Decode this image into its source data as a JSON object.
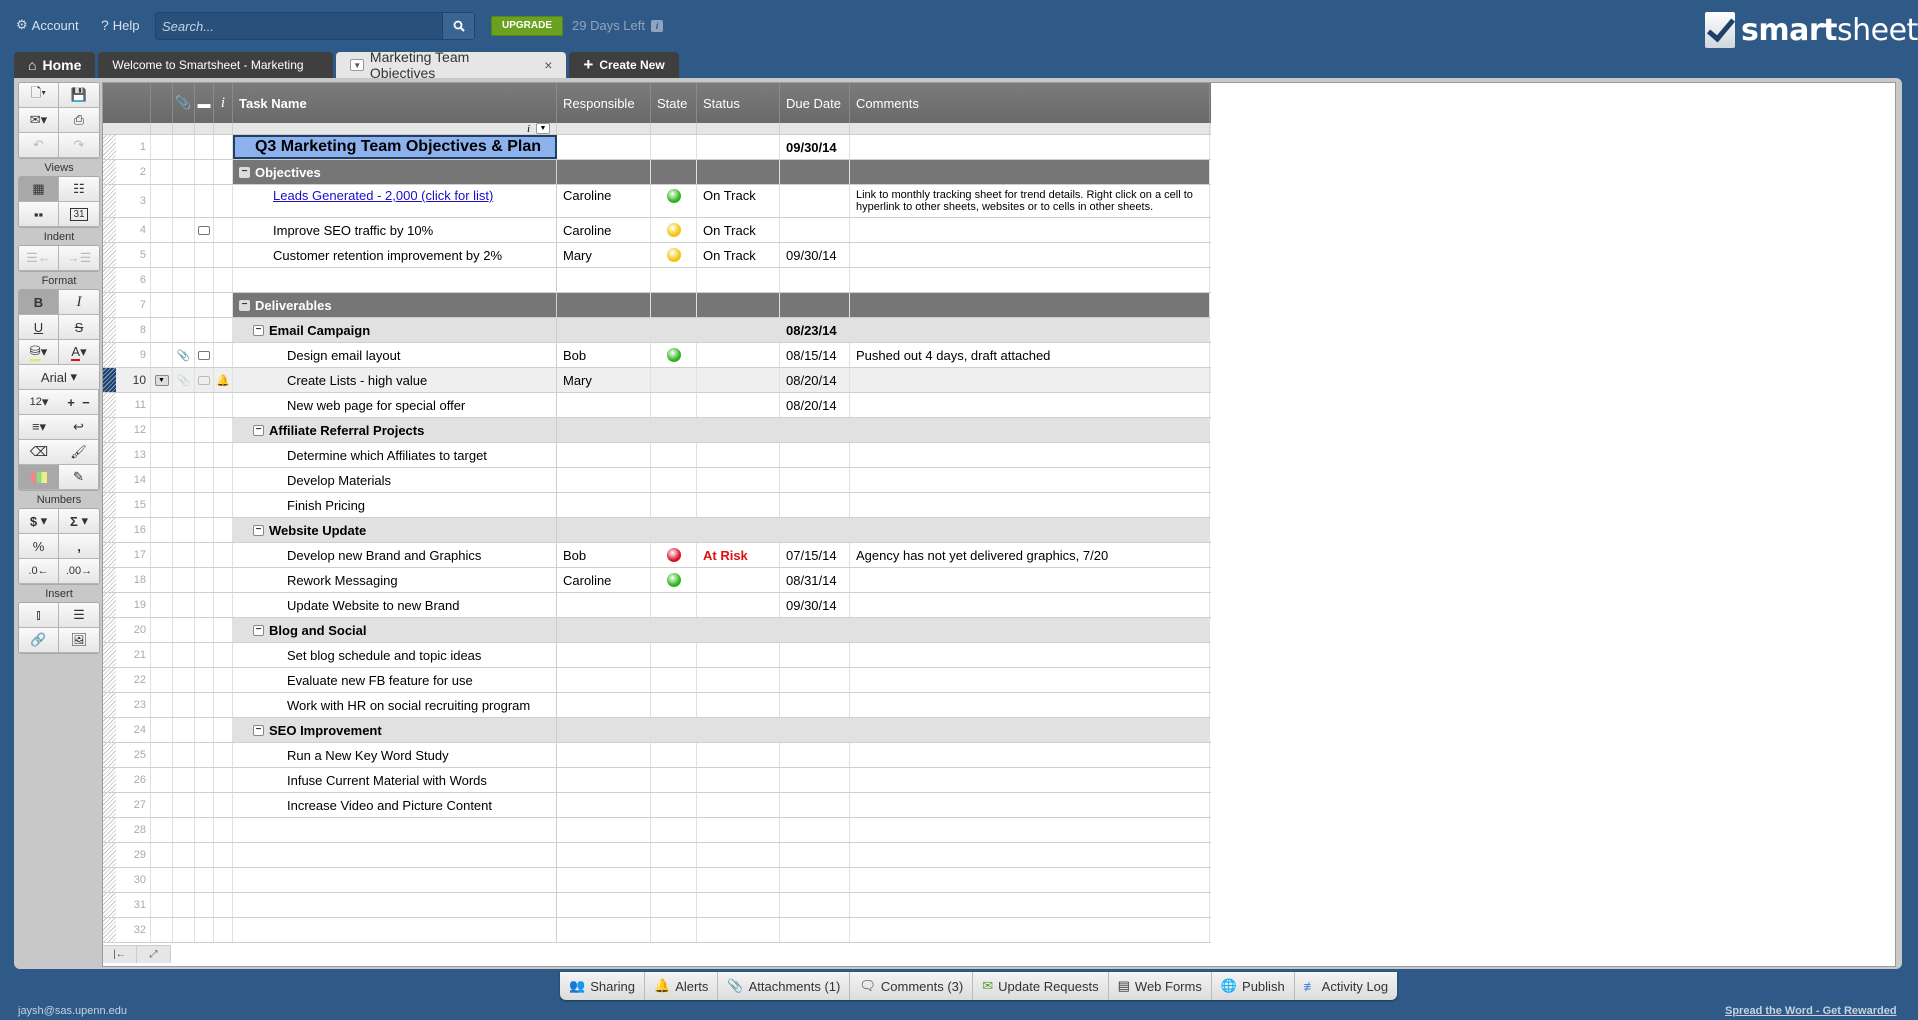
{
  "topbar": {
    "account_label": "Account",
    "help_label": "Help",
    "search_placeholder": "Search...",
    "upgrade_label": "UPGRADE",
    "trial_text": "29 Days Left",
    "logo_bold": "smart",
    "logo_rest": "sheet"
  },
  "tabs": {
    "home": "Home",
    "welcome": "Welcome to Smartsheet - Marketing",
    "active": "Marketing Team Objectives",
    "create": "Create New"
  },
  "toolbar": {
    "views_label": "Views",
    "indent_label": "Indent",
    "format_label": "Format",
    "font_name": "Arial",
    "font_size": "12",
    "numbers_label": "Numbers",
    "insert_label": "Insert"
  },
  "columns": {
    "task": "Task Name",
    "responsible": "Responsible",
    "state": "State",
    "status": "Status",
    "due": "Due Date",
    "comments": "Comments"
  },
  "colors": {
    "green": "#2db31a",
    "yellow": "#f2c40c",
    "red": "#d9102b"
  },
  "rows": [
    {
      "n": "1",
      "type": "title",
      "task": "Q3 Marketing Team Objectives & Plan",
      "resp": "",
      "state": "",
      "status": "",
      "due": "09/30/14",
      "comments": ""
    },
    {
      "n": "2",
      "type": "parent1",
      "level": 0,
      "task": "Objectives",
      "resp": "",
      "state": "",
      "status": "",
      "due": "",
      "comments": ""
    },
    {
      "n": "3",
      "type": "child",
      "level": 1,
      "link": true,
      "tall": true,
      "task": "Leads Generated - 2,000 (click for list)",
      "resp": "Caroline",
      "state": "green",
      "status": "On Track",
      "due": "",
      "comments": "Link to monthly tracking sheet for trend details. Right click on a cell to hyperlink to other sheets, websites or to cells in other sheets."
    },
    {
      "n": "4",
      "type": "child",
      "level": 1,
      "comment_icon": true,
      "task": "Improve SEO traffic by 10%",
      "resp": "Caroline",
      "state": "yellow",
      "status": "On Track",
      "due": "",
      "comments": ""
    },
    {
      "n": "5",
      "type": "child",
      "level": 1,
      "task": "Customer retention improvement by 2%",
      "resp": "Mary",
      "state": "yellow",
      "status": "On Track",
      "due": "09/30/14",
      "comments": ""
    },
    {
      "n": "6",
      "type": "empty",
      "task": "",
      "resp": "",
      "state": "",
      "status": "",
      "due": "",
      "comments": ""
    },
    {
      "n": "7",
      "type": "parent1",
      "level": 0,
      "task": "Deliverables",
      "resp": "",
      "state": "",
      "status": "",
      "due": "",
      "comments": ""
    },
    {
      "n": "8",
      "type": "parent2",
      "level": 1,
      "task": "Email Campaign",
      "resp": "",
      "state": "",
      "status": "",
      "due": "08/23/14",
      "comments": ""
    },
    {
      "n": "9",
      "type": "child",
      "level": 2,
      "attach_icon": true,
      "comment_icon": true,
      "task": "Design email layout",
      "resp": "Bob",
      "state": "green",
      "status": "",
      "due": "08/15/14",
      "comments": "Pushed out 4 days, draft attached"
    },
    {
      "n": "10",
      "type": "child",
      "level": 2,
      "selected": true,
      "task": "Create Lists - high value",
      "resp": "Mary",
      "state": "",
      "status": "",
      "due": "08/20/14",
      "comments": ""
    },
    {
      "n": "11",
      "type": "child",
      "level": 2,
      "task": "New web page for special offer",
      "resp": "",
      "state": "",
      "status": "",
      "due": "08/20/14",
      "comments": ""
    },
    {
      "n": "12",
      "type": "parent2",
      "level": 1,
      "task": "Affiliate Referral Projects",
      "resp": "",
      "state": "",
      "status": "",
      "due": "",
      "comments": ""
    },
    {
      "n": "13",
      "type": "child",
      "level": 2,
      "task": "Determine which Affiliates to target",
      "resp": "",
      "state": "",
      "status": "",
      "due": "",
      "comments": ""
    },
    {
      "n": "14",
      "type": "child",
      "level": 2,
      "task": "Develop Materials",
      "resp": "",
      "state": "",
      "status": "",
      "due": "",
      "comments": ""
    },
    {
      "n": "15",
      "type": "child",
      "level": 2,
      "task": "Finish Pricing",
      "resp": "",
      "state": "",
      "status": "",
      "due": "",
      "comments": ""
    },
    {
      "n": "16",
      "type": "parent2",
      "level": 1,
      "task": "Website Update",
      "resp": "",
      "state": "",
      "status": "",
      "due": "",
      "comments": ""
    },
    {
      "n": "17",
      "type": "child",
      "level": 2,
      "task": "Develop new Brand and Graphics",
      "resp": "Bob",
      "state": "red",
      "status": "At Risk",
      "due": "07/15/14",
      "comments": "Agency has not yet delivered graphics, 7/20"
    },
    {
      "n": "18",
      "type": "child",
      "level": 2,
      "task": "Rework Messaging",
      "resp": "Caroline",
      "state": "green",
      "status": "",
      "due": "08/31/14",
      "comments": ""
    },
    {
      "n": "19",
      "type": "child",
      "level": 2,
      "task": "Update Website to new Brand",
      "resp": "",
      "state": "",
      "status": "",
      "due": "09/30/14",
      "comments": ""
    },
    {
      "n": "20",
      "type": "parent2",
      "level": 1,
      "task": "Blog and Social",
      "resp": "",
      "state": "",
      "status": "",
      "due": "",
      "comments": ""
    },
    {
      "n": "21",
      "type": "child",
      "level": 2,
      "task": "Set blog schedule and topic ideas",
      "resp": "",
      "state": "",
      "status": "",
      "due": "",
      "comments": ""
    },
    {
      "n": "22",
      "type": "child",
      "level": 2,
      "task": "Evaluate new FB feature for use",
      "resp": "",
      "state": "",
      "status": "",
      "due": "",
      "comments": ""
    },
    {
      "n": "23",
      "type": "child",
      "level": 2,
      "task": "Work with HR on social recruiting program",
      "resp": "",
      "state": "",
      "status": "",
      "due": "",
      "comments": ""
    },
    {
      "n": "24",
      "type": "parent2",
      "level": 1,
      "task": "SEO Improvement",
      "resp": "",
      "state": "",
      "status": "",
      "due": "",
      "comments": ""
    },
    {
      "n": "25",
      "type": "child",
      "level": 2,
      "task": "Run a New Key Word Study",
      "resp": "",
      "state": "",
      "status": "",
      "due": "",
      "comments": ""
    },
    {
      "n": "26",
      "type": "child",
      "level": 2,
      "task": "Infuse Current Material with Words",
      "resp": "",
      "state": "",
      "status": "",
      "due": "",
      "comments": ""
    },
    {
      "n": "27",
      "type": "child",
      "level": 2,
      "task": "Increase Video and Picture Content",
      "resp": "",
      "state": "",
      "status": "",
      "due": "",
      "comments": ""
    },
    {
      "n": "28",
      "type": "empty",
      "task": "",
      "resp": "",
      "state": "",
      "status": "",
      "due": "",
      "comments": ""
    },
    {
      "n": "29",
      "type": "empty",
      "task": "",
      "resp": "",
      "state": "",
      "status": "",
      "due": "",
      "comments": ""
    },
    {
      "n": "30",
      "type": "empty",
      "task": "",
      "resp": "",
      "state": "",
      "status": "",
      "due": "",
      "comments": ""
    },
    {
      "n": "31",
      "type": "empty",
      "task": "",
      "resp": "",
      "state": "",
      "status": "",
      "due": "",
      "comments": ""
    },
    {
      "n": "32",
      "type": "empty",
      "task": "",
      "resp": "",
      "state": "",
      "status": "",
      "due": "",
      "comments": ""
    }
  ],
  "bottombar": {
    "sharing": "Sharing",
    "alerts": "Alerts",
    "attachments": "Attachments (1)",
    "comments": "Comments (3)",
    "update_requests": "Update Requests",
    "web_forms": "Web Forms",
    "publish": "Publish",
    "activity_log": "Activity Log"
  },
  "footer": {
    "email": "jaysh@sas.upenn.edu",
    "spread": "Spread the Word - Get Rewarded"
  }
}
